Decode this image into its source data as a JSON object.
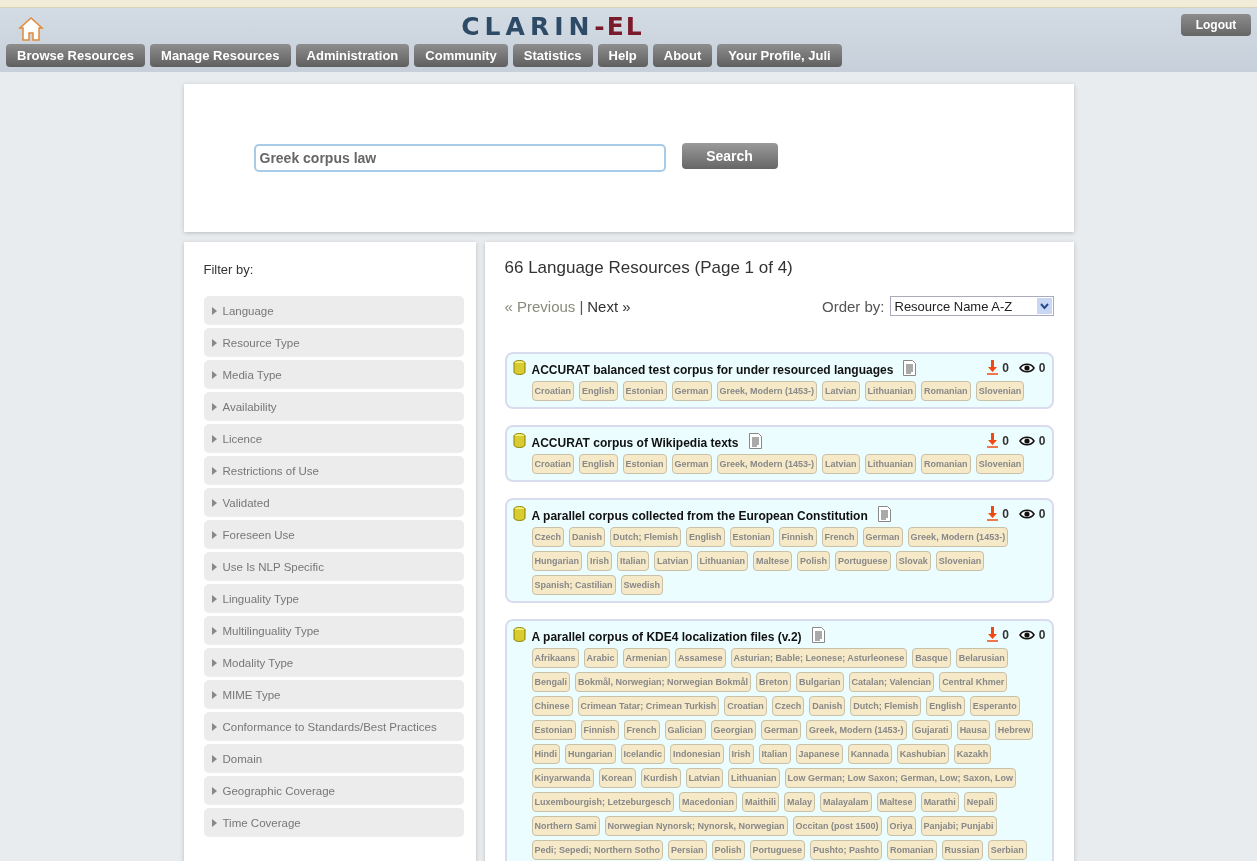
{
  "header": {
    "logo_main": "CLARIN",
    "logo_suffix": "-EL",
    "logout": "Logout",
    "nav": [
      "Browse Resources",
      "Manage Resources",
      "Administration",
      "Community",
      "Statistics",
      "Help",
      "About",
      "Your Profile, Juli"
    ]
  },
  "search": {
    "value": "Greek corpus law",
    "button": "Search"
  },
  "filters": {
    "title": "Filter by:",
    "items": [
      "Language",
      "Resource Type",
      "Media Type",
      "Availability",
      "Licence",
      "Restrictions of Use",
      "Validated",
      "Foreseen Use",
      "Use Is NLP Specific",
      "Linguality Type",
      "Multilinguality Type",
      "Modality Type",
      "MIME Type",
      "Conformance to Standards/Best Practices",
      "Domain",
      "Geographic Coverage",
      "Time Coverage"
    ]
  },
  "results": {
    "heading": "66 Language Resources (Page 1 of 4)",
    "pager": [
      {
        "label": "« Previous",
        "disabled": true
      },
      {
        "label": "Next »",
        "disabled": false
      }
    ],
    "pager_separator": "|",
    "order_label": "Order by:",
    "order_value": "Resource Name A-Z",
    "items": [
      {
        "title": "ACCURAT balanced test corpus for under resourced languages",
        "downloads": "0",
        "views": "0",
        "languages": [
          "Croatian",
          "English",
          "Estonian",
          "German",
          "Greek, Modern (1453-)",
          "Latvian",
          "Lithuanian",
          "Romanian",
          "Slovenian"
        ]
      },
      {
        "title": "ACCURAT corpus of Wikipedia texts",
        "downloads": "0",
        "views": "0",
        "languages": [
          "Croatian",
          "English",
          "Estonian",
          "German",
          "Greek, Modern (1453-)",
          "Latvian",
          "Lithuanian",
          "Romanian",
          "Slovenian"
        ]
      },
      {
        "title": "A parallel corpus collected from the European Constitution",
        "downloads": "0",
        "views": "0",
        "languages": [
          "Czech",
          "Danish",
          "Dutch; Flemish",
          "English",
          "Estonian",
          "Finnish",
          "French",
          "German",
          "Greek, Modern (1453-)",
          "Hungarian",
          "Irish",
          "Italian",
          "Latvian",
          "Lithuanian",
          "Maltese",
          "Polish",
          "Portuguese",
          "Slovak",
          "Slovenian",
          "Spanish; Castilian",
          "Swedish"
        ]
      },
      {
        "title": "A parallel corpus of KDE4 localization files (v.2)",
        "downloads": "0",
        "views": "0",
        "languages": [
          "Afrikaans",
          "Arabic",
          "Armenian",
          "Assamese",
          "Asturian; Bable; Leonese; Asturleonese",
          "Basque",
          "Belarusian",
          "Bengali",
          "Bokmål, Norwegian; Norwegian Bokmål",
          "Breton",
          "Bulgarian",
          "Catalan; Valencian",
          "Central Khmer",
          "Chinese",
          "Crimean Tatar; Crimean Turkish",
          "Croatian",
          "Czech",
          "Danish",
          "Dutch; Flemish",
          "English",
          "Esperanto",
          "Estonian",
          "Finnish",
          "French",
          "Galician",
          "Georgian",
          "German",
          "Greek, Modern (1453-)",
          "Gujarati",
          "Hausa",
          "Hebrew",
          "Hindi",
          "Hungarian",
          "Icelandic",
          "Indonesian",
          "Irish",
          "Italian",
          "Japanese",
          "Kannada",
          "Kashubian",
          "Kazakh",
          "Kinyarwanda",
          "Korean",
          "Kurdish",
          "Latvian",
          "Lithuanian",
          "Low German; Low Saxon; German, Low; Saxon, Low",
          "Luxembourgish; Letzeburgesch",
          "Macedonian",
          "Maithili",
          "Malay",
          "Malayalam",
          "Maltese",
          "Marathi",
          "Nepali",
          "Northern Sami",
          "Norwegian Nynorsk; Nynorsk, Norwegian",
          "Occitan (post 1500)",
          "Oriya",
          "Panjabi; Punjabi",
          "Pedi; Sepedi; Northern Sotho",
          "Persian",
          "Polish",
          "Portuguese",
          "Pushto; Pashto",
          "Romanian",
          "Russian",
          "Serbian"
        ]
      }
    ]
  }
}
